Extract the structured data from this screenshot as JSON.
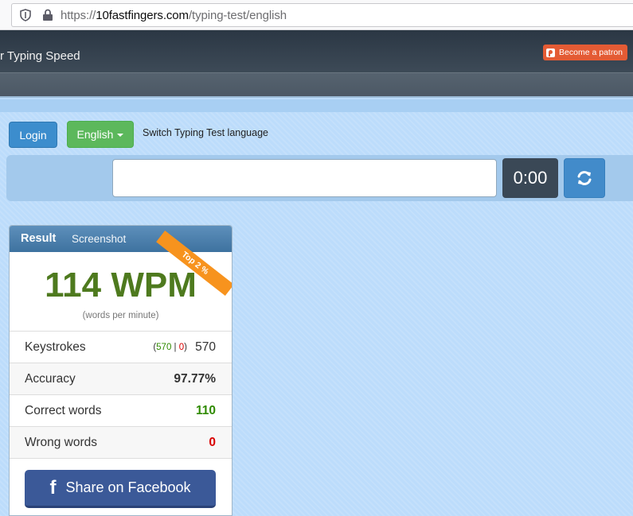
{
  "browser": {
    "url_prefix": "https://",
    "url_host": "10fastfingers.com",
    "url_path": "/typing-test/english"
  },
  "header": {
    "brand": "r Typing Speed",
    "patron_label": "Become a patron"
  },
  "toolbar": {
    "login_label": "Login",
    "language_label": "English",
    "language_hint": "Switch Typing Test language"
  },
  "typing": {
    "input_value": "",
    "timer": "0:00"
  },
  "result": {
    "title": "Result",
    "screenshot_label": "Screenshot",
    "ribbon": "Top 2 %",
    "wpm": "114 WPM",
    "wpm_sub": "(words per minute)",
    "rows": [
      {
        "label": "Keystrokes",
        "correct": "570",
        "sep": "|",
        "wrong": "0",
        "value": "570"
      },
      {
        "label": "Accuracy",
        "value": "97.77%"
      },
      {
        "label": "Correct words",
        "value": "110"
      },
      {
        "label": "Wrong words",
        "value": "0"
      }
    ],
    "share_label": "Share on Facebook"
  },
  "colors": {
    "wpm": "#4e7a1e",
    "correct": "#2f8a00",
    "wrong": "#d80000",
    "ribbon": "#f7931e",
    "facebook": "#3b5998"
  }
}
